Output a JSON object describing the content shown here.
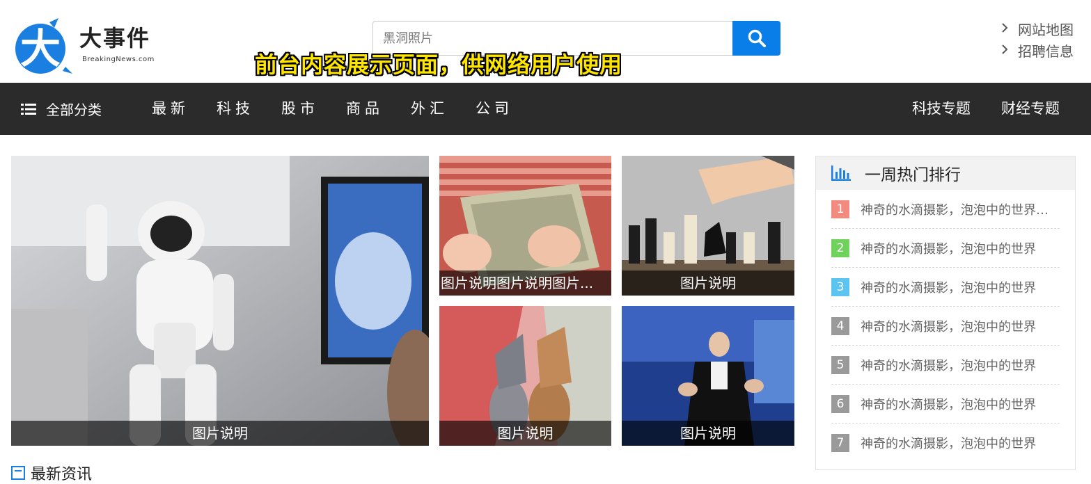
{
  "header": {
    "logo_glyph": "大",
    "logo_title": "大事件",
    "logo_subtitle": "BreakingNews.com",
    "search_placeholder": "黑洞照片",
    "slogan": "前台内容展示页面，供网络用户使用",
    "links": [
      {
        "label": "网站地图"
      },
      {
        "label": "招聘信息"
      }
    ]
  },
  "nav": {
    "all_label": "全部分类",
    "items": [
      {
        "label": "最新"
      },
      {
        "label": "科技"
      },
      {
        "label": "股市"
      },
      {
        "label": "商品"
      },
      {
        "label": "外汇"
      },
      {
        "label": "公司"
      }
    ],
    "right": [
      {
        "label": "科技专题"
      },
      {
        "label": "财经专题"
      }
    ]
  },
  "featured": [
    {
      "caption": "图片说明",
      "image": "robot-asimo"
    },
    {
      "caption": "图片说明图片说明图片...",
      "image": "money-counting"
    },
    {
      "caption": "图片说明",
      "image": "chess-hand"
    },
    {
      "caption": "图片说明",
      "image": "chess-knights-money"
    },
    {
      "caption": "图片说明",
      "image": "speaker-stage"
    }
  ],
  "ranking": {
    "title": "一周热门排行",
    "items": [
      {
        "num": "1",
        "text": "神奇的水滴摄影，泡泡中的世界泡...",
        "color": "#f28a80"
      },
      {
        "num": "2",
        "text": "神奇的水滴摄影，泡泡中的世界",
        "color": "#6fd35b"
      },
      {
        "num": "3",
        "text": "神奇的水滴摄影，泡泡中的世界",
        "color": "#5bc4f0"
      },
      {
        "num": "4",
        "text": "神奇的水滴摄影，泡泡中的世界",
        "color": "#9a9a9a"
      },
      {
        "num": "5",
        "text": "神奇的水滴摄影，泡泡中的世界",
        "color": "#9a9a9a"
      },
      {
        "num": "6",
        "text": "神奇的水滴摄影，泡泡中的世界",
        "color": "#9a9a9a"
      },
      {
        "num": "7",
        "text": "神奇的水滴摄影，泡泡中的世界",
        "color": "#9a9a9a"
      }
    ]
  },
  "latest_title": "最新资讯",
  "colors": {
    "accent": "#0a7ee8",
    "nav_bg": "#2b2b2b",
    "slogan": "#ffe600"
  }
}
